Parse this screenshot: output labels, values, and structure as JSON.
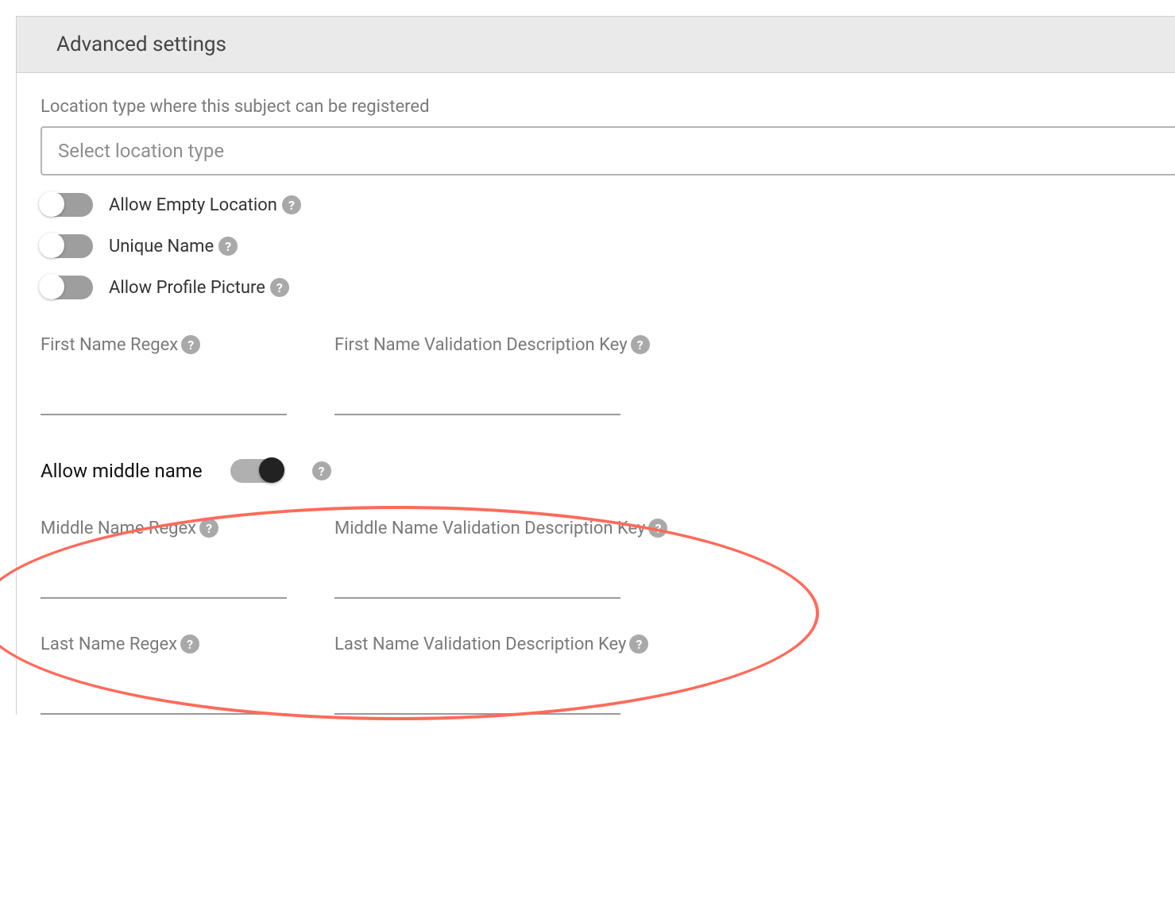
{
  "panel": {
    "title": "Advanced settings"
  },
  "location": {
    "label": "Location type where this subject can be registered",
    "placeholder": "Select location type"
  },
  "toggles": {
    "allow_empty_location": {
      "label": "Allow Empty Location",
      "on": false
    },
    "unique_name": {
      "label": "Unique Name",
      "on": false
    },
    "allow_profile_picture": {
      "label": "Allow Profile Picture",
      "on": false
    },
    "allow_middle_name": {
      "label": "Allow middle name",
      "on": true
    }
  },
  "fields": {
    "first_name_regex": {
      "label": "First Name Regex",
      "value": ""
    },
    "first_name_validation_key": {
      "label": "First Name Validation Description Key",
      "value": ""
    },
    "middle_name_regex": {
      "label": "Middle Name Regex",
      "value": ""
    },
    "middle_name_validation_key": {
      "label": "Middle Name Validation Description Key",
      "value": ""
    },
    "last_name_regex": {
      "label": "Last Name Regex",
      "value": ""
    },
    "last_name_validation_key": {
      "label": "Last Name Validation Description Key",
      "value": ""
    }
  },
  "icons": {
    "help": "?"
  }
}
